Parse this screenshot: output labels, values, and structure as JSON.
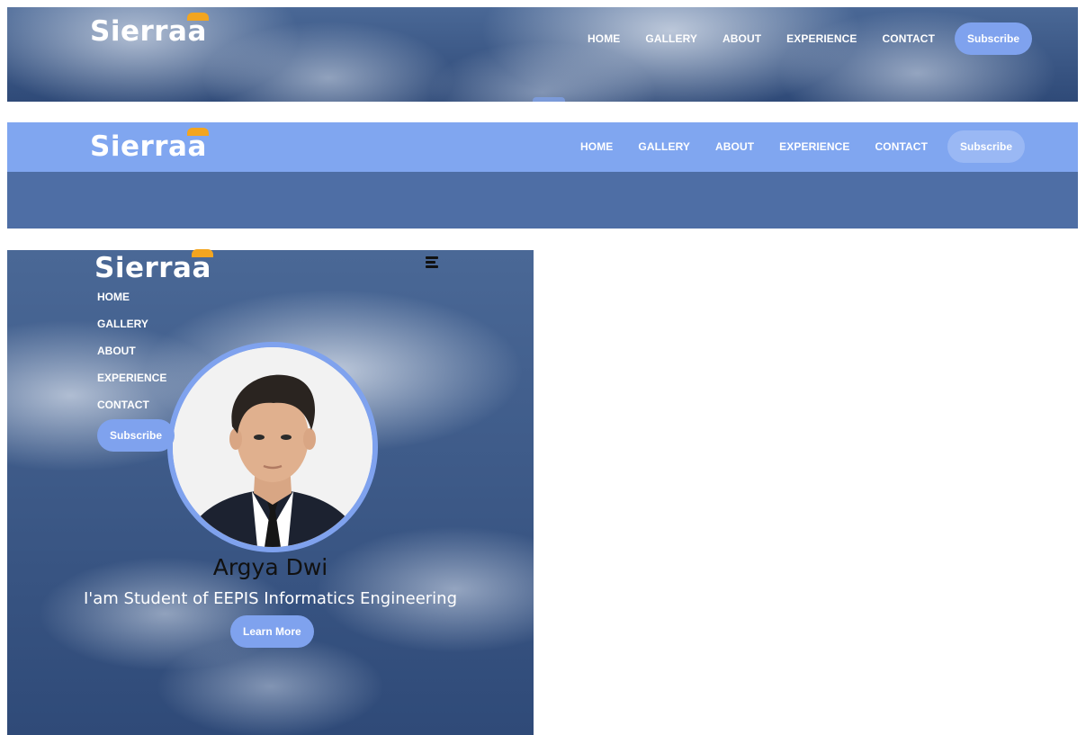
{
  "brand": {
    "name": "Sierraa",
    "accent_color": "#f3a51f"
  },
  "colors": {
    "primary": "#80a6f0",
    "navbar_scrolled": "#80a6f0",
    "hero_overlay": "#4e6ea5"
  },
  "nav": {
    "items": [
      "HOME",
      "GALLERY",
      "ABOUT",
      "EXPERIENCE",
      "CONTACT"
    ],
    "subscribe_label": "Subscribe"
  },
  "mobile": {
    "menu_icon": "hamburger-icon",
    "items": [
      "HOME",
      "GALLERY",
      "ABOUT",
      "EXPERIENCE",
      "CONTACT"
    ],
    "subscribe_label": "Subscribe"
  },
  "hero": {
    "name": "Argya Dwi",
    "tagline": "I'am Student of EEPIS Informatics Engineering",
    "cta_label": "Learn More"
  }
}
